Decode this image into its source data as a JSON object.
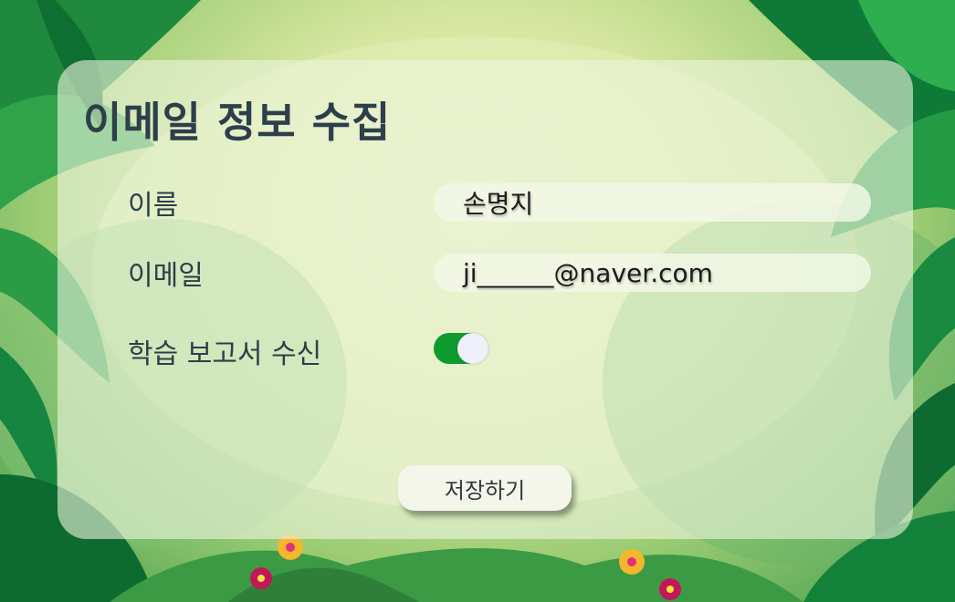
{
  "form": {
    "title": "이메일 정보 수집",
    "name_label": "이름",
    "name_value": "손명지",
    "email_label": "이메일",
    "email_value": "ji______@naver.com",
    "report_label": "학습 보고서 수신",
    "report_enabled": true,
    "save_label": "저장하기"
  },
  "colors": {
    "toggle_on": "#0e9a2f",
    "title_text": "#2d3f4a",
    "card": "#ecf4dc"
  },
  "icons": {
    "background": "jungle-leaves-illustration"
  }
}
